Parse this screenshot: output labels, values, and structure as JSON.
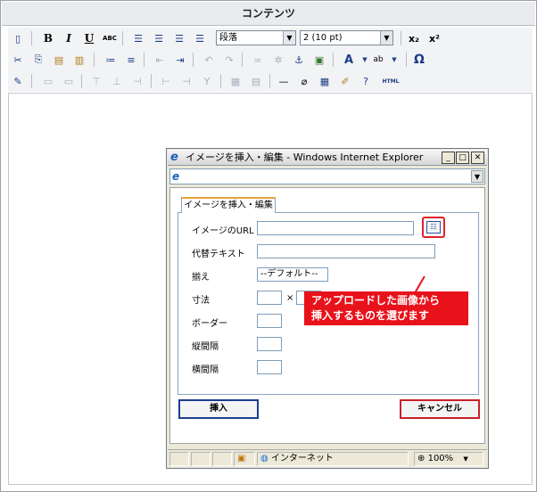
{
  "panel": {
    "title": "コンテンツ"
  },
  "toolbar": {
    "format_select": "段落",
    "size_select": "2 (10 pt)",
    "bold": "B",
    "italic": "I",
    "underline": "U",
    "strike": "ABC",
    "omega": "Ω",
    "html": "HTML"
  },
  "dialog": {
    "title": "イメージを挿入・編集 - Windows Internet Explorer",
    "tab_label": "イメージを挿入・編集",
    "fields": {
      "url_label": "イメージのURL",
      "alt_label": "代替テキスト",
      "align_label": "揃え",
      "align_value": "--デフォルト--",
      "size_label": "寸法",
      "size_times": "×",
      "border_label": "ボーダー",
      "vspace_label": "縦間隔",
      "hspace_label": "横間隔"
    },
    "insert_button": "挿入",
    "cancel_button": "キャンセル",
    "callout_line1": "アップロードした画像から",
    "callout_line2": "挿入するものを選びます",
    "status": {
      "zone": "インターネット",
      "zoom": "100%"
    }
  }
}
